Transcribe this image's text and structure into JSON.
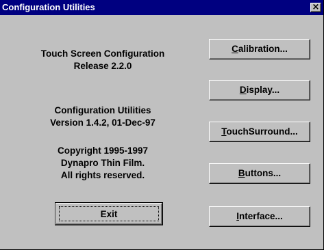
{
  "window": {
    "title": "Configuration Utilities",
    "close_glyph": "×"
  },
  "info": {
    "product_name": "Touch Screen Configuration",
    "release": "Release 2.2.0",
    "utility_name": "Configuration Utilities",
    "version": "Version 1.4.2, 01-Dec-97",
    "copyright": "Copyright 1995-1997",
    "company": "Dynapro Thin Film.",
    "rights": "All rights reserved."
  },
  "buttons": {
    "calibration": {
      "pre": "",
      "mnemonic": "C",
      "post": "alibration..."
    },
    "display": {
      "pre": "",
      "mnemonic": "D",
      "post": "isplay..."
    },
    "touchsurround": {
      "pre": "",
      "mnemonic": "T",
      "post": "ouchSurround..."
    },
    "buttons": {
      "pre": "",
      "mnemonic": "B",
      "post": "uttons..."
    },
    "interface": {
      "pre": "",
      "mnemonic": "I",
      "post": "nterface..."
    },
    "exit": {
      "pre": "E",
      "mnemonic": "x",
      "post": "it"
    }
  },
  "colors": {
    "titlebar": "#000080",
    "face": "#c0c0c0"
  }
}
